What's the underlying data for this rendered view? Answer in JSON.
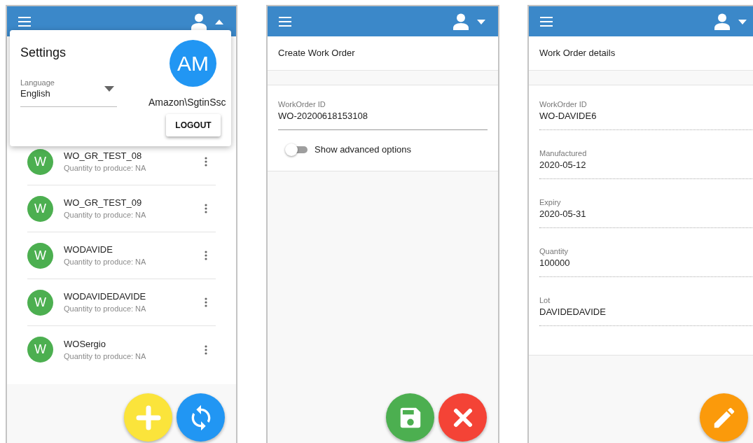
{
  "screens": [
    {
      "kind": "list",
      "user_menu_expanded": true,
      "settings": {
        "title": "Settings",
        "language_label": "Language",
        "language_value": "English",
        "avatar_initials": "AM",
        "username": "Amazon\\SgtinSsc",
        "logout": "LOGOUT"
      },
      "items": [
        {
          "avatar": "W",
          "name": "WO_GR_TEST_08",
          "subtitle": "Quantity to produce: NA"
        },
        {
          "avatar": "W",
          "name": "WO_GR_TEST_09",
          "subtitle": "Quantity to produce: NA"
        },
        {
          "avatar": "W",
          "name": "WODAVIDE",
          "subtitle": "Quantity to produce: NA"
        },
        {
          "avatar": "W",
          "name": "WODAVIDEDAVIDE",
          "subtitle": "Quantity to produce: NA"
        },
        {
          "avatar": "W",
          "name": "WOSergio",
          "subtitle": "Quantity to produce: NA"
        }
      ],
      "fabs": [
        {
          "kind": "add"
        },
        {
          "kind": "refresh"
        }
      ]
    },
    {
      "kind": "form",
      "user_menu_expanded": false,
      "title": "Create Work Order",
      "fields": [
        {
          "label": "WorkOrder ID",
          "value": "WO-20200618153108"
        }
      ],
      "toggle": {
        "label": "Show advanced options",
        "on": false
      },
      "fabs": [
        {
          "kind": "save"
        },
        {
          "kind": "cancel"
        }
      ]
    },
    {
      "kind": "details",
      "user_menu_expanded": false,
      "title": "Work Order details",
      "fields": [
        {
          "label": "WorkOrder ID",
          "value": "WO-DAVIDE6"
        },
        {
          "label": "Manufactured",
          "value": "2020-05-12"
        },
        {
          "label": "Expiry",
          "value": "2020-05-31"
        },
        {
          "label": "Quantity",
          "value": "100000"
        },
        {
          "label": "Lot",
          "value": "DAVIDEDAVIDE"
        }
      ],
      "fabs": [
        {
          "kind": "edit"
        }
      ]
    }
  ]
}
